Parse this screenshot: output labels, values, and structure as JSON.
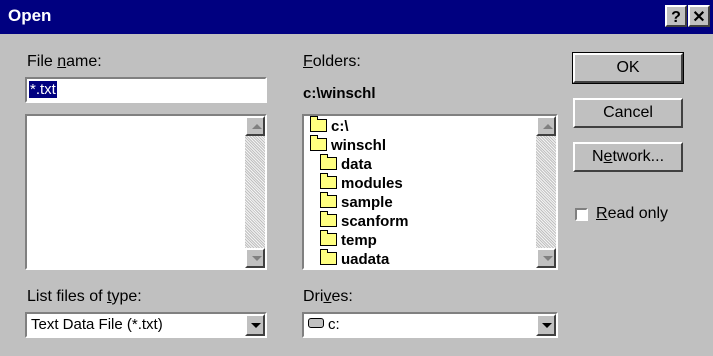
{
  "window": {
    "title": "Open",
    "help_glyph": "?",
    "close_glyph": "✕"
  },
  "file_name": {
    "label_pre": "File ",
    "label_accel": "n",
    "label_post": "ame:",
    "value": "*.txt"
  },
  "files_list": {
    "items": []
  },
  "folders": {
    "label_accel": "F",
    "label_post": "olders:",
    "current_path": "c:\\winschl",
    "tree": [
      "c:\\",
      "winschl",
      "data",
      "modules",
      "sample",
      "scanform",
      "temp",
      "uadata"
    ]
  },
  "buttons": {
    "ok": "OK",
    "cancel": "Cancel",
    "network_pre": "N",
    "network_accel": "e",
    "network_post": "twork..."
  },
  "read_only": {
    "accel": "R",
    "post": "ead only",
    "checked": false
  },
  "file_type": {
    "label_pre": "List files of ",
    "label_accel": "t",
    "label_post": "ype:",
    "value": "Text Data File (*.txt)"
  },
  "drives": {
    "label_pre": "Dri",
    "label_accel": "v",
    "label_post": "es:",
    "value": "c:"
  },
  "icons": {
    "help": "help-icon",
    "close": "close-icon",
    "folder": "folder-icon",
    "open_folder": "open-folder-icon",
    "drive": "drive-icon"
  }
}
